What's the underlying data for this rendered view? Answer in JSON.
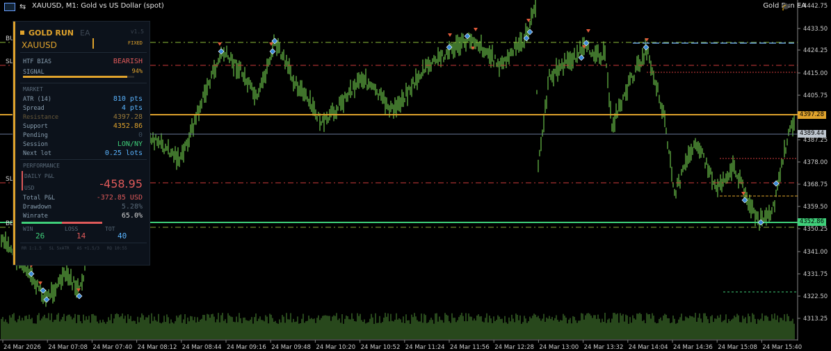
{
  "window": {
    "title": "XAUUSD, M1:  Gold vs US Dollar (spot)",
    "ea_name": "Gold Run EA"
  },
  "left_labels": {
    "buy": "BU",
    "sl1": "SL",
    "sl2": "SL",
    "be": "BE"
  },
  "panel": {
    "brand": "GOLD RUN",
    "brand_suffix": "EA",
    "version": "v1.5",
    "symbol": "XAUUSD",
    "mode": "FIXED",
    "htf_bias_label": "HTF BIAS",
    "htf_bias_value": "BEARISH",
    "signal_label": "SIGNAL",
    "signal_value": "94%",
    "signal_fill": 0.94,
    "market_header": "MARKET",
    "atr_label": "ATR (14)",
    "atr_value": "810 pts",
    "spread_label": "Spread",
    "spread_value": "4 pts",
    "resistance_label": "Resistance",
    "resistance_value": "4397.28",
    "support_label": "Support",
    "support_value": "4352.86",
    "pending_label": "Pending",
    "pending_value": "0",
    "session_label": "Session",
    "session_value": "LON/NY",
    "nextlot_label": "Next lot",
    "nextlot_value": "0.25 lots",
    "performance_header": "PERFORMANCE",
    "daily_pl_label": "DAILY P&L",
    "daily_pl_value": "-458.95",
    "daily_pl_unit": "USD",
    "total_pl_label": "Total P&L",
    "total_pl_value": "-372.85 USD",
    "drawdown_label": "Drawdown",
    "drawdown_value": "5.28%",
    "winrate_label": "Winrate",
    "winrate_value": "65.0%",
    "win_label": "WIN",
    "win_value": "26",
    "loss_label": "LOSS",
    "loss_value": "14",
    "tot_label": "TOT",
    "tot_value": "40",
    "footer": "RR 1:1.5   SL 5xATR   AS +1.5/3   RQ 10:55"
  },
  "price_axis": {
    "ticks": [
      "4442.75",
      "4433.50",
      "4424.25",
      "4415.00",
      "4405.75",
      "4397.28",
      "4389.44",
      "4387.25",
      "4378.00",
      "4368.75",
      "4359.50",
      "4352.86",
      "4350.25",
      "4341.00",
      "4331.75",
      "4322.50",
      "4313.25"
    ],
    "resistance_tag": "4397.28",
    "current_tag": "4389.44",
    "support_tag": "4352.86"
  },
  "time_axis": [
    "24 Mar 2026",
    "24 Mar 07:08",
    "24 Mar 07:40",
    "24 Mar 08:12",
    "24 Mar 08:44",
    "24 Mar 09:16",
    "24 Mar 09:48",
    "24 Mar 10:20",
    "24 Mar 10:52",
    "24 Mar 11:24",
    "24 Mar 11:56",
    "24 Mar 12:28",
    "24 Mar 13:00",
    "24 Mar 13:32",
    "24 Mar 14:04",
    "24 Mar 14:36",
    "24 Mar 15:08",
    "24 Mar 15:40"
  ],
  "colors": {
    "candle": "#6cc24a",
    "resistance": "#e0a32c",
    "support": "#3fd07a",
    "stop": "#d23c3c",
    "buy": "#8fbf3a",
    "accent": "#e0a32c",
    "bearish": "#e05a5a",
    "value_blue": "#5ab4ff",
    "value_green": "#3fd07a"
  }
}
